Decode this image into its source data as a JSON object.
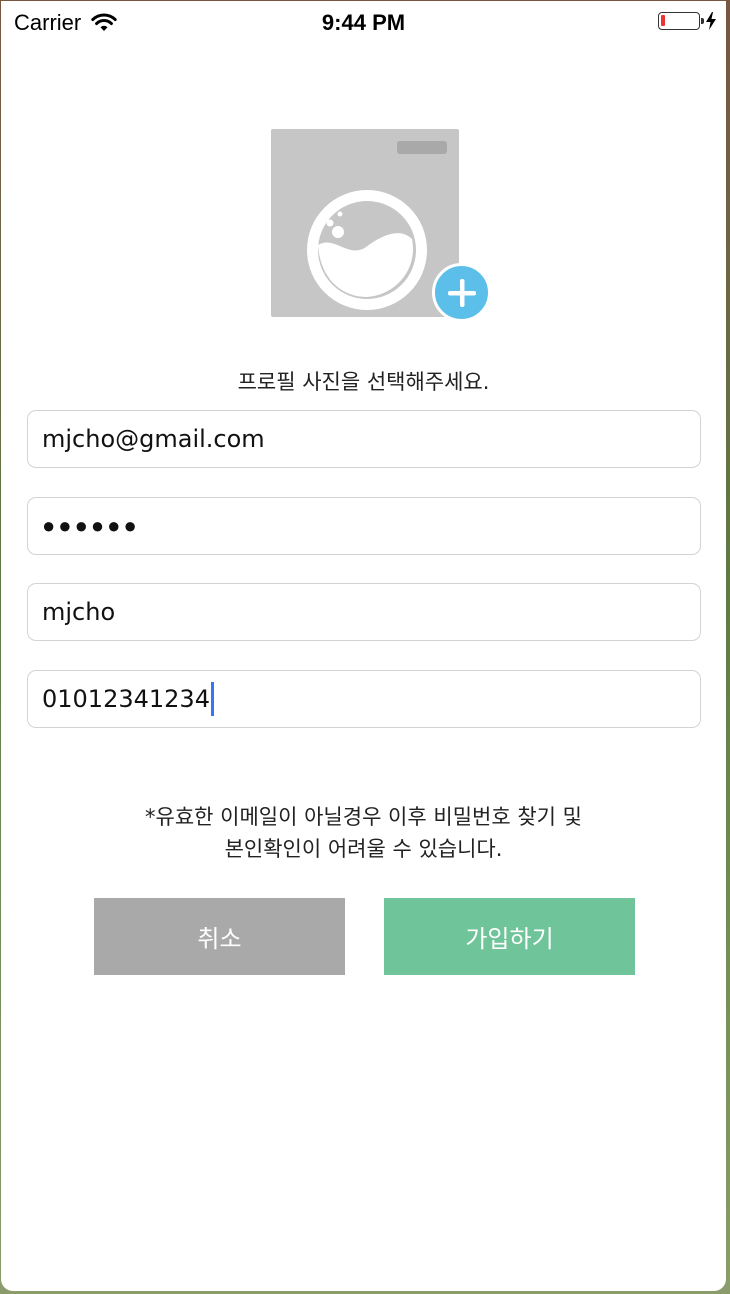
{
  "status_bar": {
    "carrier": "Carrier",
    "time": "9:44 PM"
  },
  "profile": {
    "photo_icon": "washing-machine-icon",
    "add_icon": "plus-icon",
    "add_button_color": "#5bbfea",
    "hint": "프로필 사진을 선택해주세요."
  },
  "form": {
    "email": "mjcho@gmail.com",
    "password_mask": "●●●●●●",
    "username": "mjcho",
    "phone": "01012341234"
  },
  "notice": {
    "line1": "*유효한 이메일이 아닐경우 이후 비밀번호 찾기 및",
    "line2": "본인확인이 어려울 수 있습니다."
  },
  "buttons": {
    "cancel": "취소",
    "signup": "가입하기",
    "cancel_color": "#a9a9a9",
    "signup_color": "#6fc49a"
  },
  "battery": {
    "level_percent": 10,
    "charging": true
  }
}
